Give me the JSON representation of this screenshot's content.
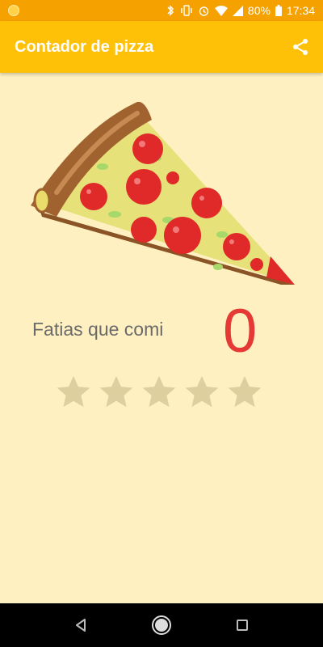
{
  "status_bar": {
    "battery": "80%",
    "time": "17:34",
    "icons": [
      "bluetooth-icon",
      "vibrate-icon",
      "alarm-icon",
      "wifi-icon",
      "signal-icon",
      "battery-icon"
    ]
  },
  "app_bar": {
    "title": "Contador de pizza",
    "share_icon": "share-icon",
    "color": "#FFC107"
  },
  "counter": {
    "label": "Fatias que comi",
    "value": "0",
    "value_color": "#E53935"
  },
  "rating": {
    "filled": 0,
    "total": 5
  },
  "nav_bar": {
    "buttons": [
      "back-icon",
      "home-icon",
      "recents-icon"
    ]
  },
  "colors": {
    "background": "#FFF0C1",
    "status_bar": "#F5A100"
  }
}
